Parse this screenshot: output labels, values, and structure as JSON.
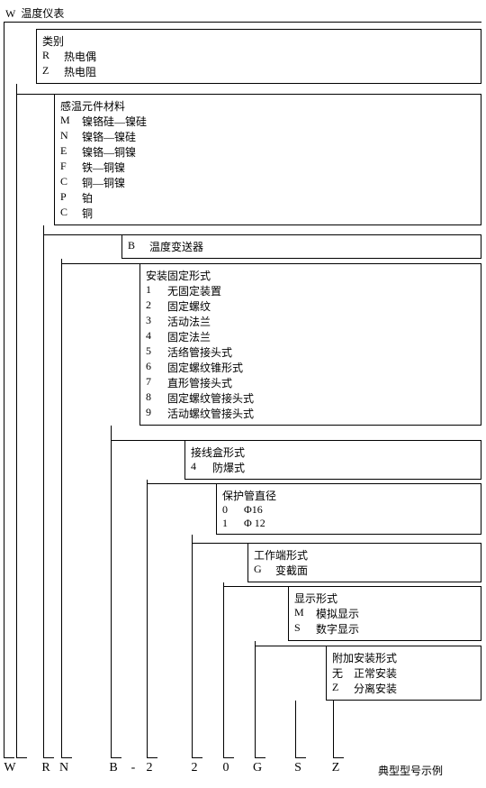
{
  "root": {
    "code": "W",
    "label": "温度仪表"
  },
  "boxes": [
    {
      "title": "类别",
      "opts": [
        {
          "code": "R",
          "label": "热电偶"
        },
        {
          "code": "Z",
          "label": "热电阻"
        }
      ]
    },
    {
      "title": "感温元件材料",
      "opts": [
        {
          "code": "M",
          "label": "镍铬硅—镍硅"
        },
        {
          "code": "N",
          "label": "镍铬—镍硅"
        },
        {
          "code": "E",
          "label": "镍铬—铜镍"
        },
        {
          "code": "F",
          "label": "铁—铜镍"
        },
        {
          "code": "C",
          "label": "铜—铜镍"
        },
        {
          "code": "P",
          "label": "铂"
        },
        {
          "code": "C",
          "label": "铜"
        }
      ]
    },
    {
      "title": "温度变送器",
      "code": "B"
    },
    {
      "title": "安装固定形式",
      "opts": [
        {
          "code": "1",
          "label": "无固定装置"
        },
        {
          "code": "2",
          "label": "固定螺纹"
        },
        {
          "code": "3",
          "label": "活动法兰"
        },
        {
          "code": "4",
          "label": "固定法兰"
        },
        {
          "code": "5",
          "label": "活络管接头式"
        },
        {
          "code": "6",
          "label": "固定螺纹锥形式"
        },
        {
          "code": "7",
          "label": "直形管接头式"
        },
        {
          "code": "8",
          "label": "固定螺纹管接头式"
        },
        {
          "code": "9",
          "label": "活动螺纹管接头式"
        }
      ]
    },
    {
      "title": "接线盒形式",
      "opts": [
        {
          "code": "4",
          "label": "防爆式"
        }
      ]
    },
    {
      "title": "保护管直径",
      "opts": [
        {
          "code": "0",
          "label": "Φ16"
        },
        {
          "code": "1",
          "label": "Φ 12"
        }
      ]
    },
    {
      "title": "工作端形式",
      "opts": [
        {
          "code": "G",
          "label": "变截面"
        }
      ]
    },
    {
      "title": "显示形式",
      "opts": [
        {
          "code": "M",
          "label": "模拟显示"
        },
        {
          "code": "S",
          "label": "数字显示"
        }
      ]
    },
    {
      "title": "附加安装形式",
      "opts": [
        {
          "code": "无",
          "label": "正常安装"
        },
        {
          "code": "Z",
          "label": "分离安装"
        }
      ]
    }
  ],
  "example_codes": [
    "W",
    "R",
    "N",
    "B",
    "-",
    "2",
    "2",
    "0",
    "G",
    "S",
    "Z"
  ],
  "example_label": "典型型号示例"
}
